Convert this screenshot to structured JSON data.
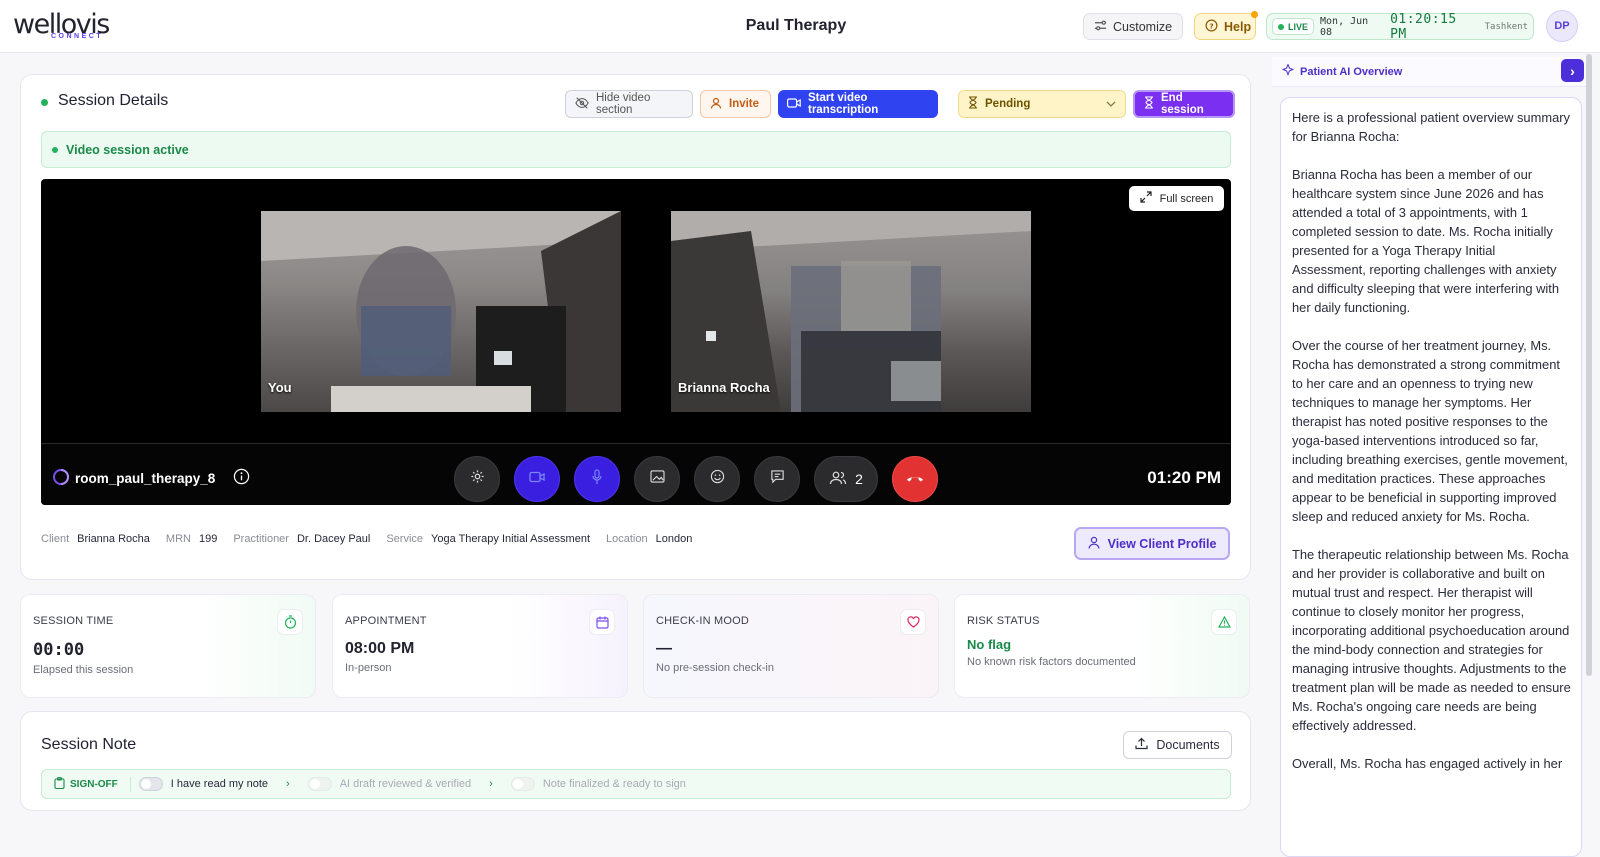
{
  "header": {
    "logo_text": "wellovis",
    "logo_sub": "CONNECT",
    "title": "Paul Therapy",
    "customize_label": "Customize",
    "help_label": "Help",
    "live_label": "LIVE",
    "date": "Mon, Jun 08",
    "time": "01:20:15 PM",
    "timezone": "Tashkent",
    "avatar_initials": "DP"
  },
  "session": {
    "title": "Session Details",
    "hide_video_label": "Hide video section",
    "invite_label": "Invite",
    "transcription_label": "Start video transcription",
    "status_select": "Pending",
    "end_label": "End session",
    "banner": "Video session active",
    "fullscreen_label": "Full screen",
    "feeds": [
      {
        "label": "You"
      },
      {
        "label": "Brianna Rocha"
      }
    ],
    "room": "room_paul_therapy_8",
    "participants_count": "2",
    "video_time": "01:20 PM",
    "meta": {
      "client_k": "Client",
      "client_v": "Brianna Rocha",
      "mrn_k": "MRN",
      "mrn_v": "199",
      "practitioner_k": "Practitioner",
      "practitioner_v": "Dr. Dacey Paul",
      "service_k": "Service",
      "service_v": "Yoga Therapy Initial Assessment",
      "location_k": "Location",
      "location_v": "London"
    },
    "view_profile_label": "View Client Profile"
  },
  "cards": [
    {
      "label": "SESSION TIME",
      "value": "00:00",
      "sub": "Elapsed this session",
      "icon": "stopwatch-icon",
      "color": "#22b35a"
    },
    {
      "label": "APPOINTMENT",
      "value": "08:00 PM",
      "sub": "In-person",
      "icon": "calendar-icon",
      "color": "#7b4ff0"
    },
    {
      "label": "CHECK-IN MOOD",
      "value": "—",
      "sub": "No pre-session check-in",
      "icon": "heart-icon",
      "color": "#e0245e"
    },
    {
      "label": "RISK STATUS",
      "value": "No flag",
      "sub": "No known risk factors documented",
      "icon": "warning-icon",
      "color": "#22b35a"
    }
  ],
  "note": {
    "title": "Session Note",
    "documents_label": "Documents",
    "signoff_label": "SIGN-OFF",
    "steps": [
      "I have read my note",
      "AI draft reviewed & verified",
      "Note finalized & ready to sign"
    ]
  },
  "ai": {
    "title": "Patient AI Overview",
    "paragraphs": [
      "Here is a professional patient overview summary for Brianna Rocha:",
      "Brianna Rocha has been a member of our healthcare system since June 2026 and has attended a total of 3 appointments, with 1 completed session to date. Ms. Rocha initially presented for a Yoga Therapy Initial Assessment, reporting challenges with anxiety and difficulty sleeping that were interfering with her daily functioning.",
      "Over the course of her treatment journey, Ms. Rocha has demonstrated a strong commitment to her care and an openness to trying new techniques to manage her symptoms. Her therapist has noted positive responses to the yoga-based interventions introduced so far, including breathing exercises, gentle movement, and meditation practices. These approaches appear to be beneficial in supporting improved sleep and reduced anxiety for Ms. Rocha.",
      "The therapeutic relationship between Ms. Rocha and her provider is collaborative and built on mutual trust and respect. Her therapist will continue to closely monitor her progress, incorporating additional psychoeducation around the mind-body connection and strategies for managing intrusive thoughts. Adjustments to the treatment plan will be made as needed to ensure Ms. Rocha's ongoing care needs are being effectively addressed.",
      "Overall, Ms. Rocha has engaged actively in her"
    ]
  }
}
